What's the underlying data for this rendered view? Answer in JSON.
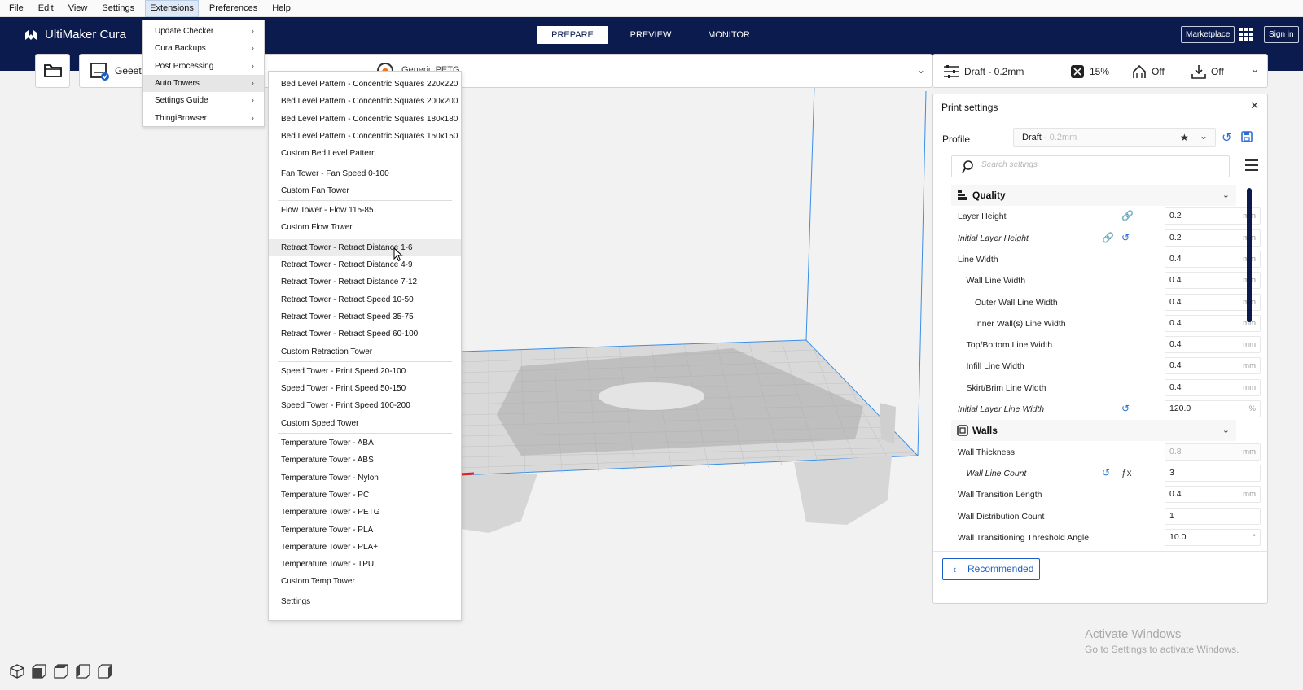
{
  "menubar": {
    "items": [
      "File",
      "Edit",
      "View",
      "Settings",
      "Extensions",
      "Preferences",
      "Help"
    ]
  },
  "header": {
    "app_name": "UltiMaker Cura",
    "stages": [
      "PREPARE",
      "PREVIEW",
      "MONITOR"
    ],
    "active_stage": "PREPARE",
    "marketplace": "Marketplace",
    "sign_in": "Sign in"
  },
  "toolbar": {
    "printer_name": "Geeete",
    "material": "Generic PETG"
  },
  "print_summary": {
    "profile": "Draft - 0.2mm",
    "infill": "15%",
    "support": "Off",
    "adhesion": "Off"
  },
  "extensions_menu": {
    "items": [
      "Update Checker",
      "Cura Backups",
      "Post Processing",
      "Auto Towers",
      "Settings Guide",
      "ThingiBrowser"
    ],
    "highlighted": "Auto Towers"
  },
  "auto_towers_menu": {
    "groups": [
      [
        "Bed Level Pattern - Concentric Squares 220x220",
        "Bed Level Pattern - Concentric Squares 200x200",
        "Bed Level Pattern - Concentric Squares 180x180",
        "Bed Level Pattern - Concentric Squares 150x150",
        "Custom Bed Level Pattern"
      ],
      [
        "Fan Tower - Fan Speed 0-100",
        "Custom Fan Tower"
      ],
      [
        "Flow Tower - Flow 115-85",
        "Custom Flow Tower"
      ],
      [
        "Retract Tower - Retract Distance 1-6",
        "Retract Tower - Retract Distance 4-9",
        "Retract Tower - Retract Distance 7-12",
        "Retract Tower - Retract Speed 10-50",
        "Retract Tower - Retract Speed 35-75",
        "Retract Tower - Retract Speed 60-100",
        "Custom Retraction Tower"
      ],
      [
        "Speed Tower - Print Speed 20-100",
        "Speed Tower - Print Speed 50-150",
        "Speed Tower - Print Speed 100-200",
        "Custom Speed Tower"
      ],
      [
        "Temperature Tower - ABA",
        "Temperature Tower - ABS",
        "Temperature Tower - Nylon",
        "Temperature Tower - PC",
        "Temperature Tower - PETG",
        "Temperature Tower - PLA",
        "Temperature Tower - PLA+",
        "Temperature Tower - TPU",
        "Custom Temp Tower"
      ],
      [
        "Settings"
      ]
    ],
    "highlighted": "Retract Tower - Retract Distance 1-6"
  },
  "print_settings": {
    "title": "Print settings",
    "profile_label": "Profile",
    "profile_name": "Draft",
    "profile_sub": " - 0.2mm",
    "search_placeholder": "Search settings",
    "categories": [
      {
        "name": "Quality",
        "settings": [
          {
            "label": "Layer Height",
            "value": "0.2",
            "unit": "mm",
            "indent": 0,
            "italic": false,
            "icons": [
              "link"
            ]
          },
          {
            "label": "Initial Layer Height",
            "value": "0.2",
            "unit": "mm",
            "indent": 0,
            "italic": true,
            "icons": [
              "link",
              "reset"
            ]
          },
          {
            "label": "Line Width",
            "value": "0.4",
            "unit": "mm",
            "indent": 0,
            "italic": false,
            "icons": []
          },
          {
            "label": "Wall Line Width",
            "value": "0.4",
            "unit": "mm",
            "indent": 1,
            "italic": false,
            "icons": []
          },
          {
            "label": "Outer Wall Line Width",
            "value": "0.4",
            "unit": "mm",
            "indent": 2,
            "italic": false,
            "icons": []
          },
          {
            "label": "Inner Wall(s) Line Width",
            "value": "0.4",
            "unit": "mm",
            "indent": 2,
            "italic": false,
            "icons": []
          },
          {
            "label": "Top/Bottom Line Width",
            "value": "0.4",
            "unit": "mm",
            "indent": 1,
            "italic": false,
            "icons": []
          },
          {
            "label": "Infill Line Width",
            "value": "0.4",
            "unit": "mm",
            "indent": 1,
            "italic": false,
            "icons": []
          },
          {
            "label": "Skirt/Brim Line Width",
            "value": "0.4",
            "unit": "mm",
            "indent": 1,
            "italic": false,
            "icons": []
          },
          {
            "label": "Initial Layer Line Width",
            "value": "120.0",
            "unit": "%",
            "indent": 0,
            "italic": true,
            "icons": [
              "reset"
            ]
          }
        ]
      },
      {
        "name": "Walls",
        "settings": [
          {
            "label": "Wall Thickness",
            "value": "0.8",
            "unit": "mm",
            "indent": 0,
            "italic": false,
            "icons": [],
            "disabled": true
          },
          {
            "label": "Wall Line Count",
            "value": "3",
            "unit": "",
            "indent": 1,
            "italic": true,
            "icons": [
              "reset",
              "function"
            ]
          },
          {
            "label": "Wall Transition Length",
            "value": "0.4",
            "unit": "mm",
            "indent": 0,
            "italic": false,
            "icons": []
          },
          {
            "label": "Wall Distribution Count",
            "value": "1",
            "unit": "",
            "indent": 0,
            "italic": false,
            "icons": []
          },
          {
            "label": "Wall Transitioning Threshold Angle",
            "value": "10.0",
            "unit": "°",
            "indent": 0,
            "italic": false,
            "icons": []
          }
        ]
      }
    ],
    "recommended_label": "Recommended"
  },
  "watermark": {
    "line1": "Activate Windows",
    "line2": "Go to Settings to activate Windows."
  },
  "colors": {
    "header_bg": "#0c1b4d",
    "accent": "#1b5ec9",
    "build_volume": "#3a8ee6"
  }
}
